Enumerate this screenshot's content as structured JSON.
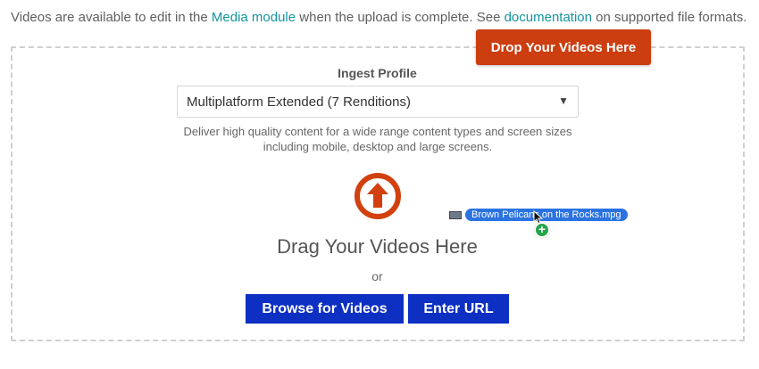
{
  "intro": {
    "text_before": "Videos are available to edit in the ",
    "media_link": "Media module",
    "text_middle": " when the upload is complete. See ",
    "doc_link": "documentation",
    "text_after": " on supported file formats."
  },
  "tooltip": {
    "label": "Drop Your Videos Here"
  },
  "profile": {
    "label": "Ingest Profile",
    "selected": "Multiplatform Extended (7 Renditions)",
    "description": "Deliver high quality content for a wide range content types and screen sizes including mobile, desktop and large screens."
  },
  "upload": {
    "drag_text": "Drag Your Videos Here",
    "or_text": "or",
    "browse_label": "Browse for Videos",
    "url_label": "Enter URL"
  },
  "drag_ghost": {
    "filename": "Brown Pelicans on the Rocks.mpg"
  },
  "colors": {
    "accent_teal": "#13959e",
    "tooltip_orange": "#cc3d0f",
    "button_blue": "#0d2fc2",
    "upload_icon": "#d2400f"
  }
}
